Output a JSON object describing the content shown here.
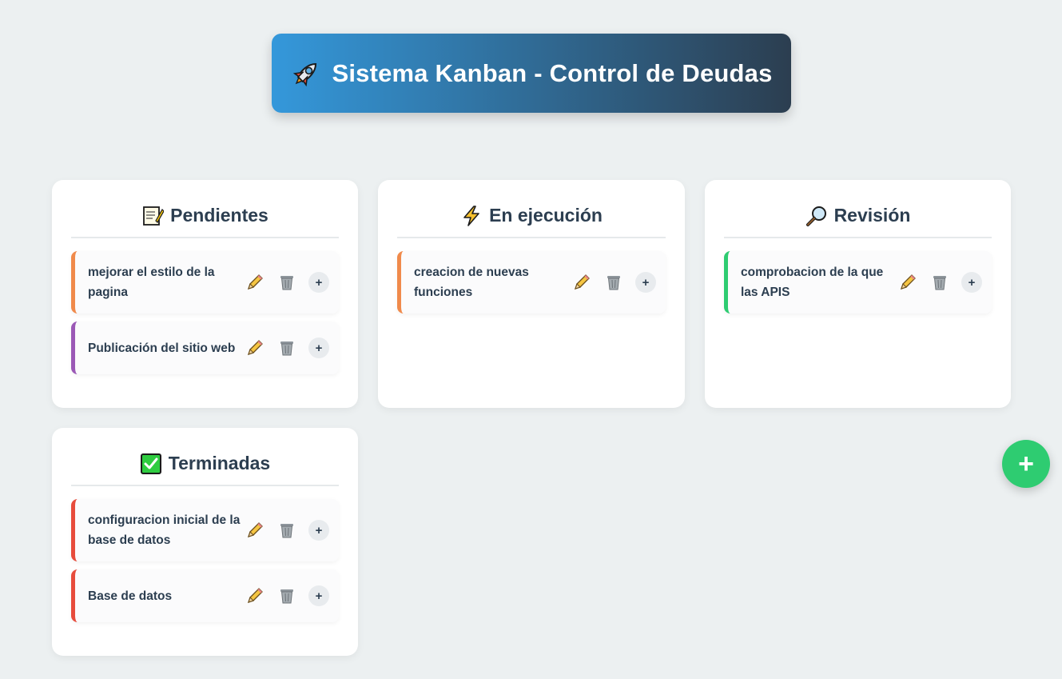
{
  "header": {
    "title": "Sistema Kanban - Control de Deudas",
    "icon": "rocket-icon"
  },
  "columns": [
    {
      "title": "Pendientes",
      "icon": "memo-icon",
      "cards": [
        {
          "title": "mejorar el estilo de la pagina",
          "accent": "#f08a4b"
        },
        {
          "title": "Publicación del sitio web",
          "accent": "#9b59b6"
        }
      ]
    },
    {
      "title": "En ejecución",
      "icon": "lightning-icon",
      "cards": [
        {
          "title": "creacion de nuevas funciones",
          "accent": "#f08a4b"
        }
      ]
    },
    {
      "title": "Revisión",
      "icon": "magnifier-icon",
      "cards": [
        {
          "title": "comprobacion de la que las APIS",
          "accent": "#2ecc71"
        }
      ]
    },
    {
      "title": "Terminadas",
      "icon": "check-box-icon",
      "cards": [
        {
          "title": "configuracion inicial de la base de datos",
          "accent": "#e74c3c"
        },
        {
          "title": "Base de datos",
          "accent": "#e74c3c"
        }
      ]
    }
  ],
  "card_actions": {
    "plus_label": "+"
  },
  "fab": {
    "label": "+",
    "color": "#2ecc71"
  },
  "colors": {
    "background": "#ecf0f1",
    "header_start": "#3498db",
    "header_end": "#2c3e50",
    "text": "#2c3e50"
  }
}
